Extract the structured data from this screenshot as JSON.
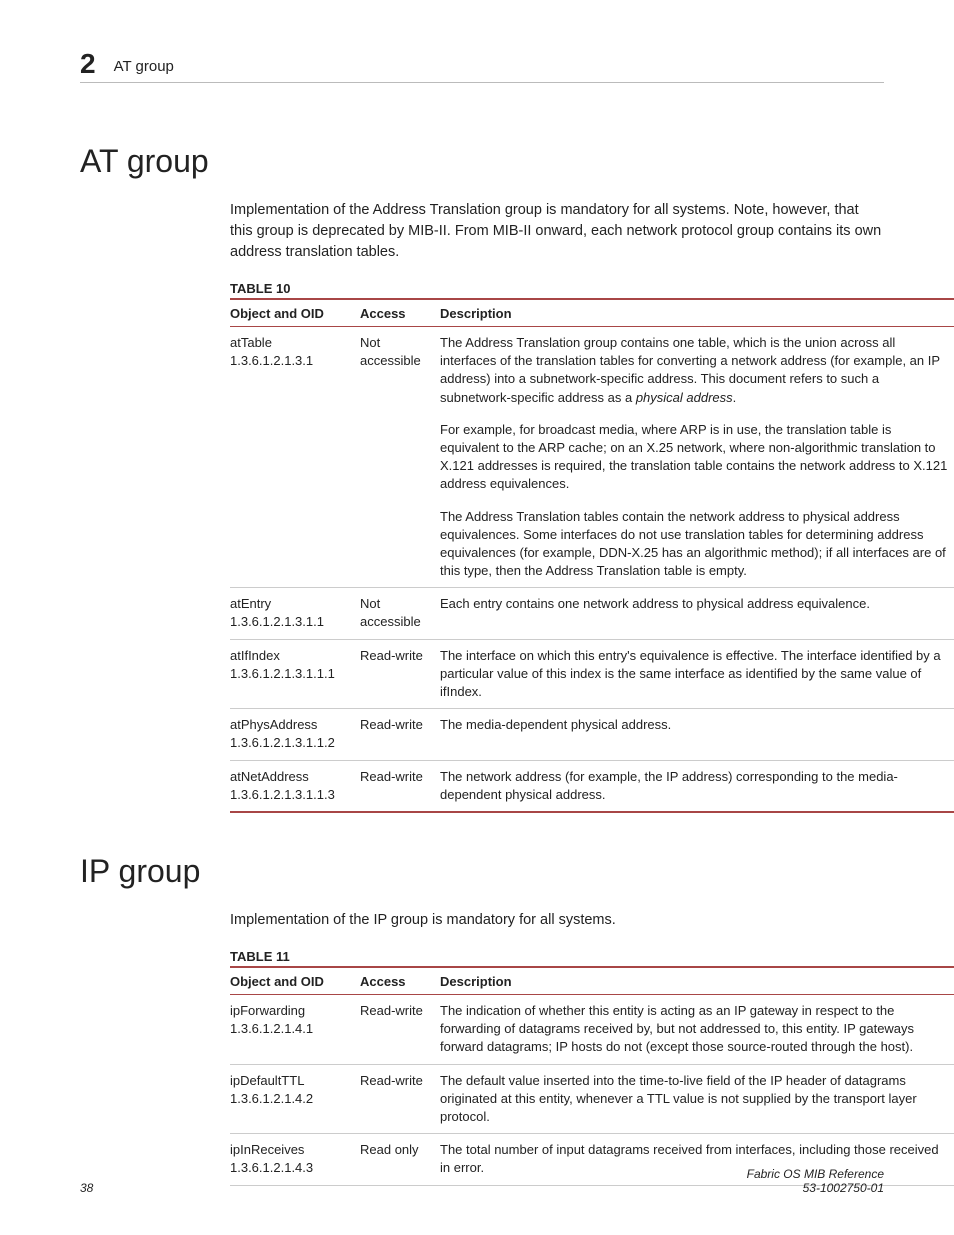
{
  "header": {
    "chapter_number": "2",
    "title": "AT group"
  },
  "section1": {
    "heading": "AT group",
    "intro": "Implementation of the Address Translation group is mandatory for all systems. Note, however, that this group is deprecated by MIB-II. From MIB-II onward, each network protocol group contains its own address translation tables.",
    "table_caption": "TABLE 10",
    "columns": {
      "object": "Object and OID",
      "access": "Access",
      "description": "Description"
    },
    "rows": [
      {
        "name": "atTable",
        "oid": "1.3.6.1.2.1.3.1",
        "access": "Not accessible",
        "desc": {
          "p1a": "The Address Translation group contains one table, which is the union across all interfaces of the translation tables for converting a network address (for example, an IP address) into a subnetwork-specific address. This document refers to such a subnetwork-specific address as a ",
          "p1b_italic": "physical address",
          "p1c": ".",
          "p2": "For example, for broadcast media, where ARP is in use, the translation table is equivalent to the ARP cache; on an X.25 network, where non-algorithmic translation to X.121 addresses is required, the translation table contains the network address to X.121 address equivalences.",
          "p3": "The Address Translation tables contain the network address to physical address equivalences. Some interfaces do not use translation tables for determining address equivalences (for example, DDN-X.25 has an algorithmic method); if all interfaces are of this type, then the Address Translation table is empty."
        }
      },
      {
        "name": "atEntry",
        "oid": "1.3.6.1.2.1.3.1.1",
        "access": "Not accessible",
        "desc": {
          "p1": "Each entry contains one network address to physical address equivalence."
        }
      },
      {
        "name": "atIfIndex",
        "oid": "1.3.6.1.2.1.3.1.1.1",
        "access": "Read-write",
        "desc": {
          "p1": "The interface on which this entry's equivalence is effective. The interface identified by a particular value of this index is the same interface as identified by the same value of ifIndex."
        }
      },
      {
        "name": "atPhysAddress",
        "oid": "1.3.6.1.2.1.3.1.1.2",
        "access": "Read-write",
        "desc": {
          "p1": "The media-dependent physical address."
        }
      },
      {
        "name": "atNetAddress",
        "oid": "1.3.6.1.2.1.3.1.1.3",
        "access": "Read-write",
        "desc": {
          "p1": "The network address (for example, the IP address) corresponding to the media-dependent physical address."
        }
      }
    ]
  },
  "section2": {
    "heading": "IP group",
    "intro": "Implementation of the IP group is mandatory for all systems.",
    "table_caption": "TABLE 11",
    "columns": {
      "object": "Object and OID",
      "access": "Access",
      "description": "Description"
    },
    "rows": [
      {
        "name": "ipForwarding",
        "oid": "1.3.6.1.2.1.4.1",
        "access": "Read-write",
        "desc": {
          "p1": "The indication of whether this entity is acting as an IP gateway in respect to the forwarding of datagrams received by, but not addressed to, this entity. IP gateways forward datagrams; IP hosts do not (except those source-routed through the host)."
        }
      },
      {
        "name": "ipDefaultTTL",
        "oid": "1.3.6.1.2.1.4.2",
        "access": "Read-write",
        "desc": {
          "p1": "The default value inserted into the time-to-live field of the IP header of datagrams originated at this entity, whenever a TTL value is not supplied by the transport layer protocol."
        }
      },
      {
        "name": "ipInReceives",
        "oid": "1.3.6.1.2.1.4.3",
        "access": "Read only",
        "desc": {
          "p1": "The total number of input datagrams received from interfaces, including those received in error."
        }
      }
    ]
  },
  "footer": {
    "page_number": "38",
    "doc_title": "Fabric OS MIB Reference",
    "doc_id": "53-1002750-01"
  }
}
